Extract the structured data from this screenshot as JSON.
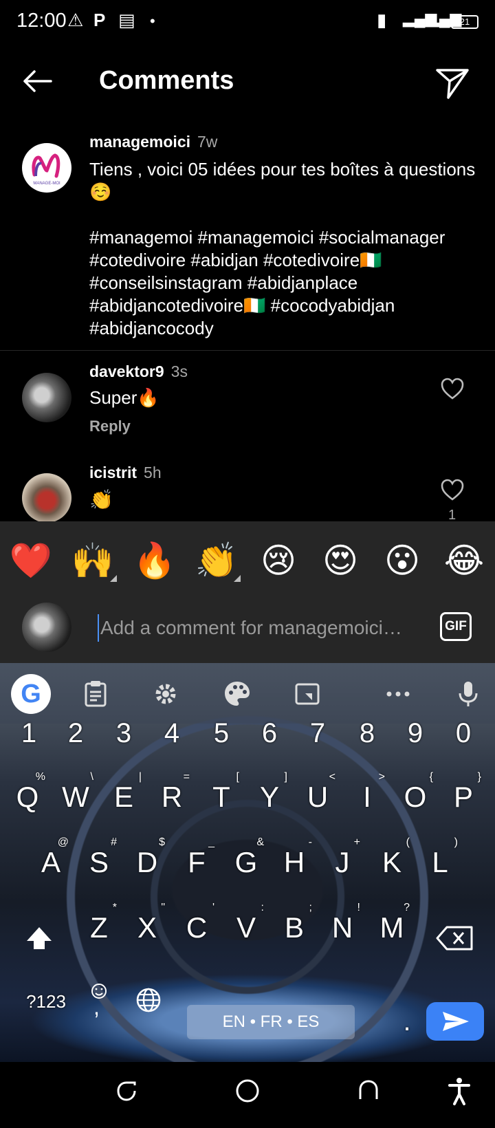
{
  "status_bar": {
    "time": "12:00",
    "battery": "21"
  },
  "header": {
    "title": "Comments"
  },
  "caption": {
    "username": "managemoici",
    "time": "7w",
    "text": "Tiens , voici 05 idées pour tes boîtes à questions ☺️\n\n#managemoi #managemoici #socialmanager #cotedivoire #abidjan #cotedivoire🇨🇮 #conseilsinstagram #abidjanplace #abidjancotedivoire🇨🇮 #cocodyabidjan #abidjancocody",
    "avatar_text": "MANAGE-MOI"
  },
  "comments": [
    {
      "username": "davektor9",
      "time": "3s",
      "text": "Super🔥",
      "reply_label": "Reply"
    },
    {
      "username": "icistrit",
      "time": "5h",
      "text": "👏",
      "like_count": "1"
    }
  ],
  "quick_emojis": [
    "❤️",
    "🙌",
    "🔥",
    "👏",
    "😢",
    "😍",
    "😮",
    "😂"
  ],
  "composer": {
    "placeholder": "Add a comment for managemoici…",
    "gif_label": "GIF"
  },
  "keyboard": {
    "google_label": "G",
    "numbers": [
      "1",
      "2",
      "3",
      "4",
      "5",
      "6",
      "7",
      "8",
      "9",
      "0"
    ],
    "row1": [
      {
        "k": "Q",
        "h": "%"
      },
      {
        "k": "W",
        "h": "\\"
      },
      {
        "k": "E",
        "h": "|"
      },
      {
        "k": "R",
        "h": "="
      },
      {
        "k": "T",
        "h": "["
      },
      {
        "k": "Y",
        "h": "]"
      },
      {
        "k": "U",
        "h": "<"
      },
      {
        "k": "I",
        "h": ">"
      },
      {
        "k": "O",
        "h": "{"
      },
      {
        "k": "P",
        "h": "}"
      }
    ],
    "row2": [
      {
        "k": "A",
        "h": "@"
      },
      {
        "k": "S",
        "h": "#"
      },
      {
        "k": "D",
        "h": "$"
      },
      {
        "k": "F",
        "h": "_"
      },
      {
        "k": "G",
        "h": "&"
      },
      {
        "k": "H",
        "h": "-"
      },
      {
        "k": "J",
        "h": "+"
      },
      {
        "k": "K",
        "h": "("
      },
      {
        "k": "L",
        "h": ")"
      }
    ],
    "row3": [
      {
        "k": "Z",
        "h": "*"
      },
      {
        "k": "X",
        "h": "\""
      },
      {
        "k": "C",
        "h": "'"
      },
      {
        "k": "V",
        "h": ":"
      },
      {
        "k": "B",
        "h": ";"
      },
      {
        "k": "N",
        "h": "!"
      },
      {
        "k": "M",
        "h": "?"
      }
    ],
    "symbols_label": "?123",
    "emoji_comma": ",",
    "space_label": "EN • FR • ES",
    "period": "."
  },
  "colors": {
    "accent": "#3b82f6",
    "panel": "#262626",
    "muted": "#a8a8a8"
  }
}
